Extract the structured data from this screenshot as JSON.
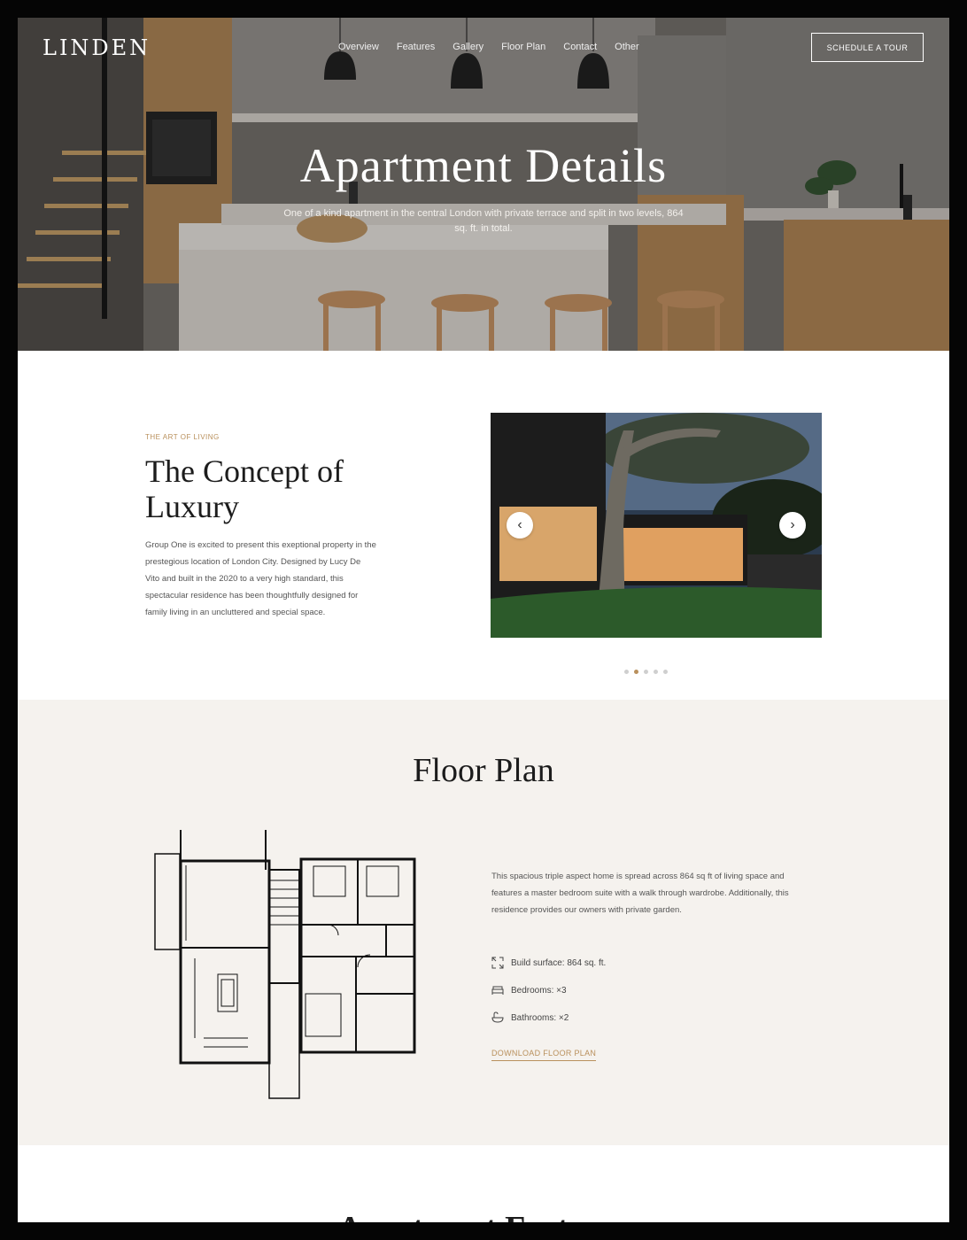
{
  "header": {
    "logo": "LINDEN",
    "nav": [
      "Overview",
      "Features",
      "Gallery",
      "Floor Plan",
      "Contact",
      "Other"
    ],
    "cta": "SCHEDULE A TOUR"
  },
  "hero": {
    "title": "Apartment Details",
    "subtitle": "One of a kind apartment in the central London with private terrace and split in two levels, 864 sq. ft. in total."
  },
  "concept": {
    "eyebrow": "THE ART OF LIVING",
    "title": "The Concept of Luxury",
    "body": "Group One is excited to present this exeptional property in the prestegious location of London City. Designed by Lucy De Vito and built in the 2020 to a very high standard, this spectacular residence has been thoughtfully designed for family living in an uncluttered and special space.",
    "slider": {
      "prev_icon": "chevron-left-icon",
      "next_icon": "chevron-right-icon",
      "slide_count": 5,
      "active_slide": 2
    }
  },
  "floor_plan": {
    "title": "Floor Plan",
    "description": "This spacious triple aspect home is spread across 864 sq ft of living space and features a master bedroom suite with a walk through wardrobe. Additionally, this residence provides our owners with private garden.",
    "specs": [
      {
        "icon": "expand-icon",
        "label": "Build surface: 864 sq. ft."
      },
      {
        "icon": "bed-icon",
        "label": "Bedrooms: ×3"
      },
      {
        "icon": "bath-icon",
        "label": "Bathrooms: ×2"
      }
    ],
    "download": "DOWNLOAD FLOOR PLAN"
  },
  "features": {
    "title": "Apartment Features"
  },
  "colors": {
    "accent": "#b9905c",
    "section_bg": "#f5f2ee",
    "text_dark": "#1c1c1c"
  }
}
